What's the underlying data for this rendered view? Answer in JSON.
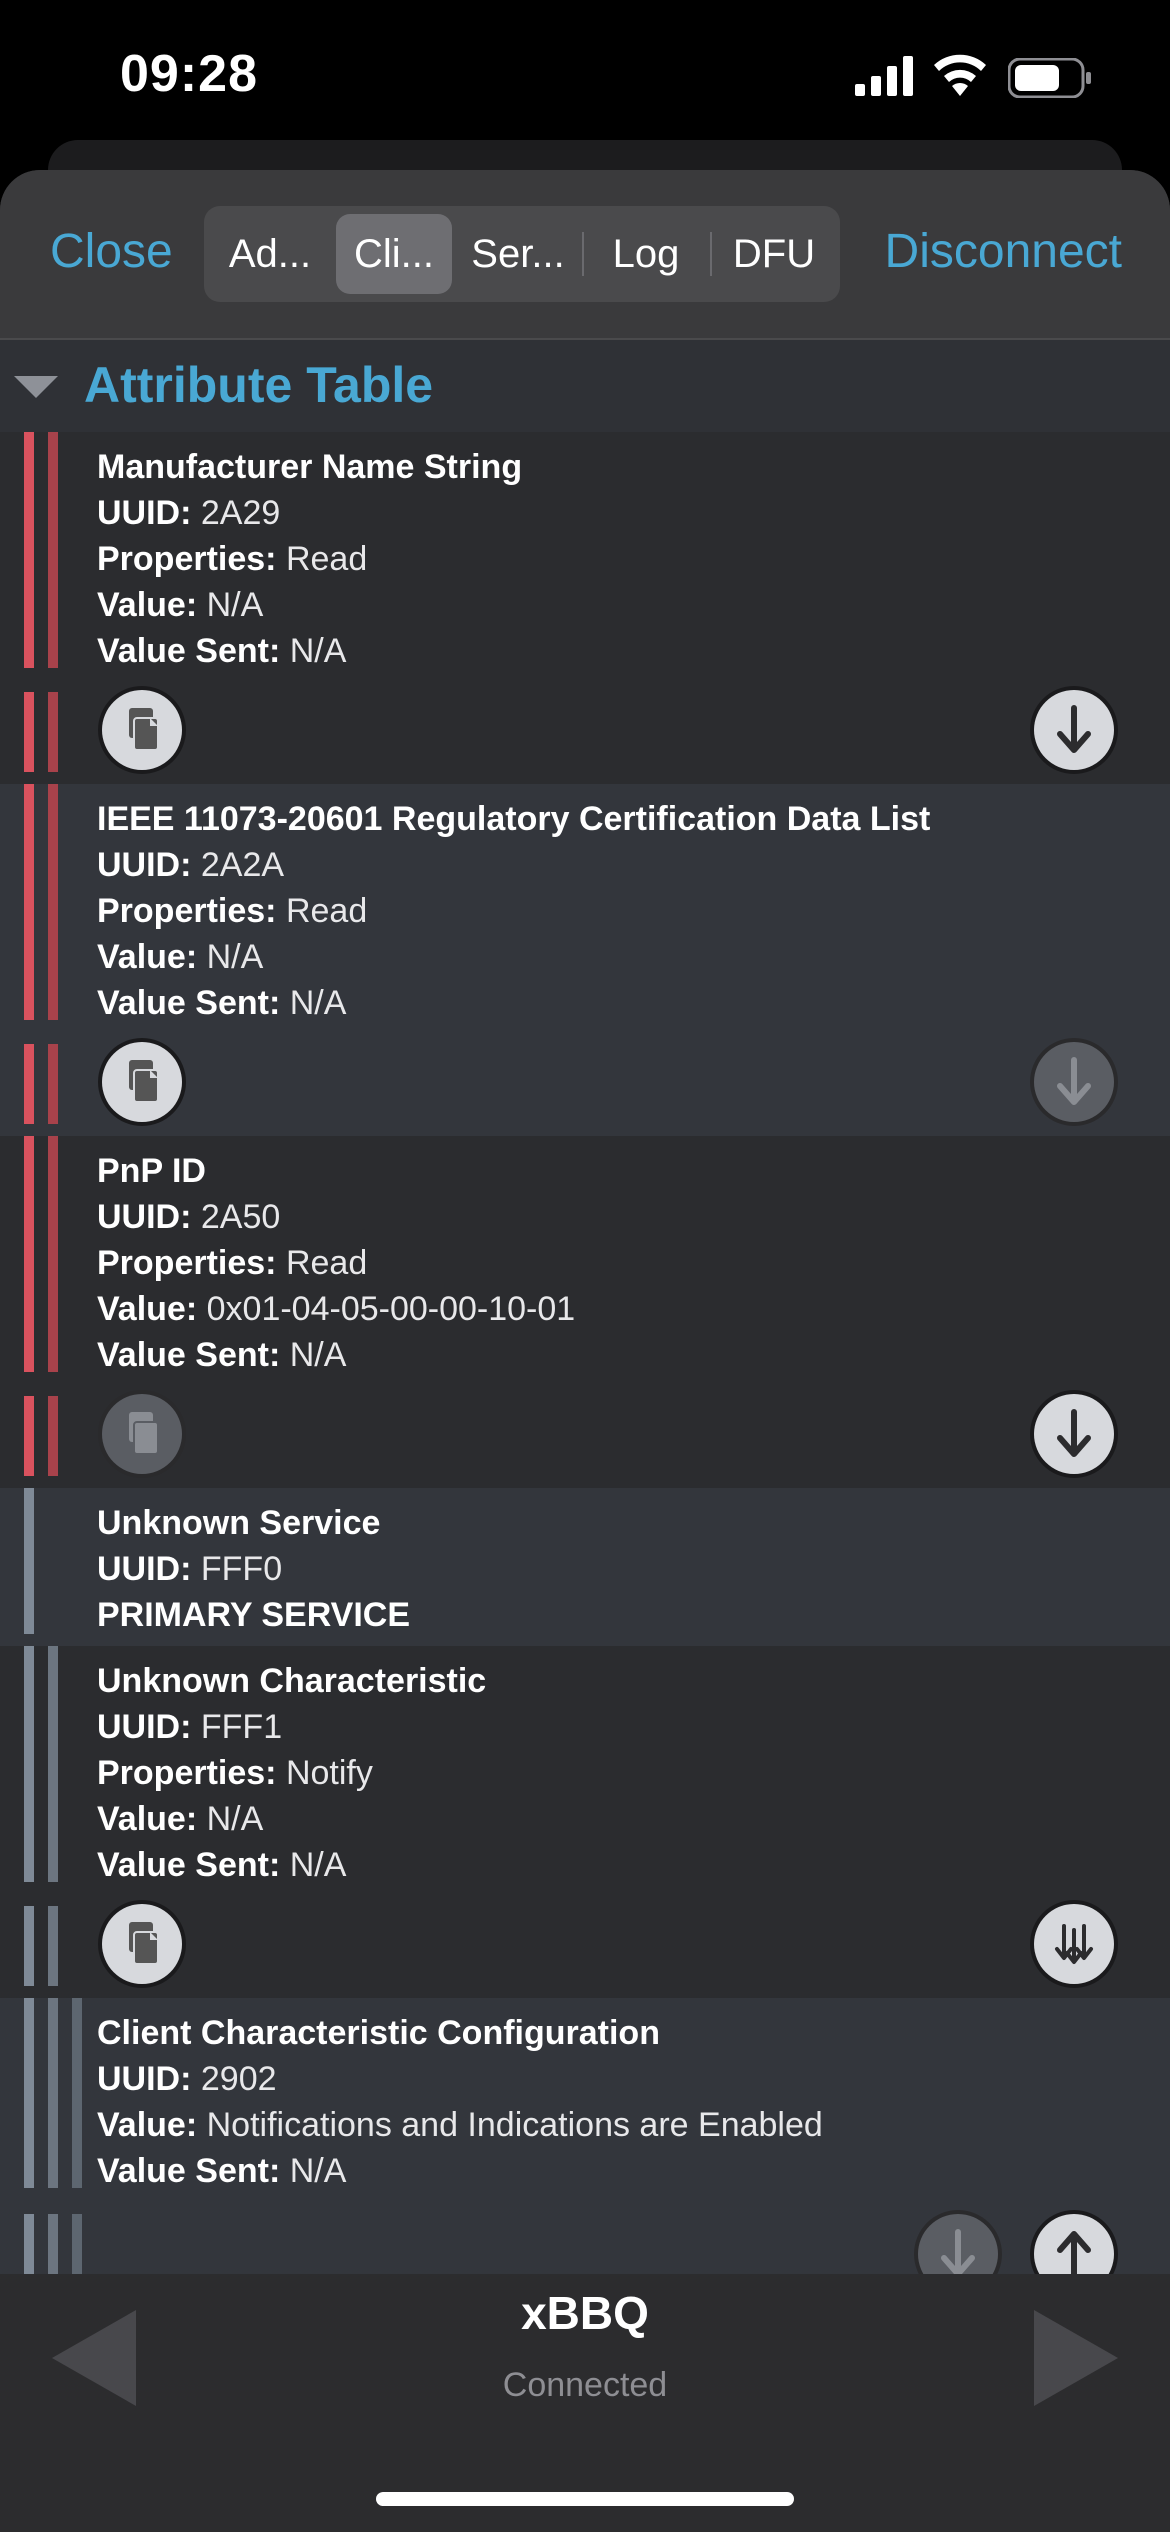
{
  "status_bar": {
    "time": "09:28"
  },
  "toolbar": {
    "close_label": "Close",
    "disconnect_label": "Disconnect",
    "tabs": [
      {
        "label": "Ad..."
      },
      {
        "label": "Cli..."
      },
      {
        "label": "Ser..."
      },
      {
        "label": "Log"
      },
      {
        "label": "DFU"
      }
    ],
    "active_tab": "Cli..."
  },
  "section": {
    "title": "Attribute Table",
    "expanded": true
  },
  "labels": {
    "uuid": "UUID:",
    "properties": "Properties:",
    "value": "Value:",
    "value_sent": "Value Sent:"
  },
  "attributes": [
    {
      "name": "Manufacturer Name String",
      "uuid": "2A29",
      "properties": "Read",
      "value": "N/A",
      "value_sent": "N/A",
      "copy_enabled": true,
      "read_enabled": true
    },
    {
      "name": "IEEE 11073-20601 Regulatory Certification Data List",
      "uuid": "2A2A",
      "properties": "Read",
      "value": "N/A",
      "value_sent": "N/A",
      "copy_enabled": true,
      "read_enabled": false
    },
    {
      "name": "PnP ID",
      "uuid": "2A50",
      "properties": "Read",
      "value": "0x01-04-05-00-00-10-01",
      "value_sent": "N/A",
      "copy_enabled": false,
      "read_enabled": true
    },
    {
      "name": "Unknown Service",
      "uuid": "FFF0",
      "service_type": "PRIMARY SERVICE"
    },
    {
      "name": "Unknown Characteristic",
      "uuid": "FFF1",
      "properties": "Notify",
      "value": "N/A",
      "value_sent": "N/A",
      "copy_enabled": true,
      "notify_enabled": true
    },
    {
      "name": "Client Characteristic Configuration",
      "uuid": "2902",
      "value": "Notifications and Indications are Enabled",
      "value_sent": "N/A",
      "read_enabled": false,
      "write_enabled": true
    }
  ],
  "device": {
    "name": "xBBQ",
    "status": "Connected"
  },
  "colors": {
    "accent": "#49a8d4",
    "service_bar_red": "#d9525e",
    "service_bar_gray": "#7f8a97"
  },
  "icons": {
    "copy": "copy-document-icon",
    "read": "arrow-down-icon",
    "notify": "notify-arrows-icon",
    "write": "arrow-up-icon"
  }
}
